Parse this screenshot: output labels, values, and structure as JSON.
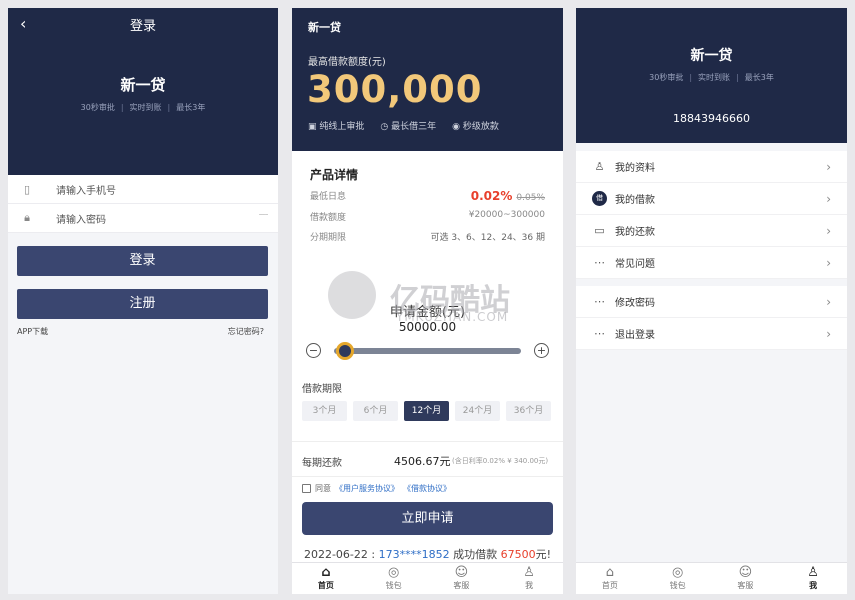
{
  "colors": {
    "navy": "#1f2947",
    "button": "#3a4670",
    "gold": "#f2c87a",
    "red": "#e8402c",
    "link_blue": "#2f6ec6"
  },
  "login": {
    "back_icon": "chevron-left-icon",
    "title": "登录",
    "brand": "新一贷",
    "tags": [
      "30秒审批",
      "实时到账",
      "最长3年"
    ],
    "phone_placeholder": "请输入手机号",
    "password_placeholder": "请输入密码",
    "login_btn": "登录",
    "register_btn": "注册",
    "app_download": "APP下载",
    "forgot": "忘记密码?"
  },
  "loan": {
    "brand": "新一贷",
    "limit_label": "最高借款额度(元)",
    "limit_amount": "300,000",
    "features": [
      "纯线上审批",
      "最长借三年",
      "秒级放款"
    ],
    "detail_title": "产品详情",
    "rows": [
      {
        "label": "最低日息",
        "value": "0.02%",
        "old": "0.05%"
      },
      {
        "label": "借款额度",
        "value": "¥20000~300000"
      },
      {
        "label": "分期期限",
        "value": "可选 3、6、12、24、36 期"
      }
    ],
    "apply_label": "申请金额(元)",
    "apply_value": "50000.00",
    "slider_fraction": 0.06,
    "term_label": "借款期限",
    "terms": [
      "3个月",
      "6个月",
      "12个月",
      "24个月",
      "36个月"
    ],
    "term_selected": "12个月",
    "repay_label": "每期还款",
    "repay_value": "4506.67元",
    "repay_note": "(含日利率0.02%  ¥ 340.00元)",
    "agree_prefix": "同意",
    "agree_link1": "《用户服务协议》",
    "agree_link2": "《借款协议》",
    "submit": "立即申请",
    "ticker_date": "2022-06-22 :",
    "ticker_phone": "173****1852",
    "ticker_mid": "成功借款",
    "ticker_amount": "67500",
    "ticker_unit": "元!"
  },
  "tabs": [
    {
      "label": "首页",
      "icon": "home-icon",
      "glyph": "⌂"
    },
    {
      "label": "钱包",
      "icon": "wallet-icon",
      "glyph": "◎"
    },
    {
      "label": "客服",
      "icon": "service-icon",
      "glyph": "☺"
    },
    {
      "label": "我",
      "icon": "user-icon",
      "glyph": "♙"
    }
  ],
  "profile": {
    "brand": "新一贷",
    "tags": [
      "30秒审批",
      "实时到账",
      "最长3年"
    ],
    "phone": "18843946660",
    "menu1": [
      "我的资料",
      "我的借款",
      "我的还款",
      "常见问题"
    ],
    "menu2": [
      "修改密码",
      "退出登录"
    ],
    "loan_badge": "借"
  },
  "watermark": {
    "title": "亿码酷站",
    "sub": "YMKUZHAN.COM"
  }
}
